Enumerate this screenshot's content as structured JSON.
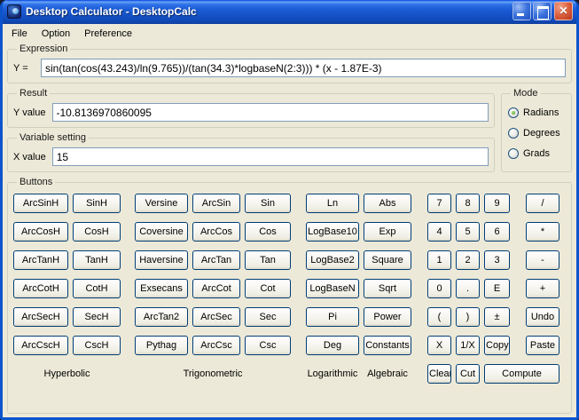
{
  "window": {
    "title": "Desktop Calculator - DesktopCalc"
  },
  "menu": {
    "items": [
      "File",
      "Option",
      "Preference"
    ]
  },
  "expression": {
    "group_label": "Expression",
    "label": "Y =",
    "value": "sin(tan(cos(43.243)/ln(9.765))/(tan(34.3)*logbaseN(2:3))) * (x - 1.87E-3)"
  },
  "result": {
    "group_label": "Result",
    "label": "Y value",
    "value": "-10.8136970860095"
  },
  "mode": {
    "group_label": "Mode",
    "options": [
      {
        "label": "Radians",
        "selected": true
      },
      {
        "label": "Degrees",
        "selected": false
      },
      {
        "label": "Grads",
        "selected": false
      }
    ]
  },
  "variable": {
    "group_label": "Variable setting",
    "label": "X value",
    "value": "15"
  },
  "buttons": {
    "group_label": "Buttons",
    "grid": [
      [
        "ArcSinH",
        "SinH",
        "Versine",
        "ArcSin",
        "Sin",
        "Ln",
        "Abs",
        "7",
        "8",
        "9",
        "/"
      ],
      [
        "ArcCosH",
        "CosH",
        "Coversine",
        "ArcCos",
        "Cos",
        "LogBase10",
        "Exp",
        "4",
        "5",
        "6",
        "*"
      ],
      [
        "ArcTanH",
        "TanH",
        "Haversine",
        "ArcTan",
        "Tan",
        "LogBase2",
        "Square",
        "1",
        "2",
        "3",
        "-"
      ],
      [
        "ArcCotH",
        "CotH",
        "Exsecans",
        "ArcCot",
        "Cot",
        "LogBaseN",
        "Sqrt",
        "0",
        ".",
        "E",
        "+"
      ],
      [
        "ArcSecH",
        "SecH",
        "ArcTan2",
        "ArcSec",
        "Sec",
        "Pi",
        "Power",
        "(",
        ")",
        "±",
        "Undo"
      ],
      [
        "ArcCscH",
        "CscH",
        "Pythag",
        "ArcCsc",
        "Csc",
        "Deg",
        "Constants",
        "X",
        "1/X",
        "Copy",
        "Paste"
      ]
    ],
    "category_labels": {
      "hyperbolic": "Hyperbolic",
      "trigonometric": "Trigonometric",
      "logarithmic": "Logarithmic",
      "algebraic": "Algebraic"
    },
    "actions": {
      "clear": "Clear",
      "cut": "Cut",
      "compute": "Compute"
    }
  },
  "colors": {
    "window_bg": "#ECE9D8",
    "titlebar_blue": "#1C5CD6",
    "button_border": "#003C74",
    "input_border": "#7F9DB9",
    "close_red": "#C33C1D",
    "radio_dot_green": "#4E9A2E"
  }
}
